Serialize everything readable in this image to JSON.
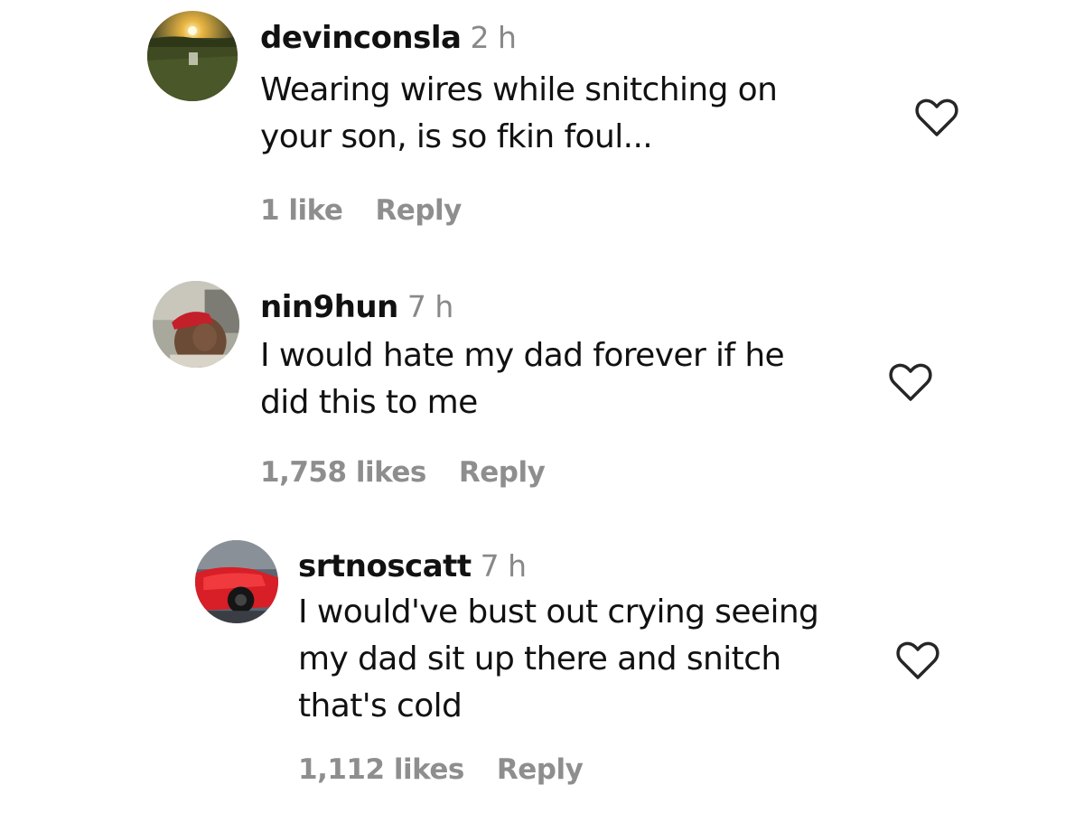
{
  "comments": [
    {
      "username": "devinconsla",
      "time": "2 h",
      "lines": [
        "Wearing wires while snitching on",
        "your son, is so fkin foul..."
      ],
      "likes": "1 like",
      "reply": "Reply",
      "avatar": "sunset-field-photo",
      "like_icon": "heart-outline-icon"
    },
    {
      "username": "nin9hun",
      "time": "7 h",
      "lines": [
        "I would hate my dad forever if he",
        "did this to me"
      ],
      "likes": "1,758 likes",
      "reply": "Reply",
      "avatar": "man-red-cap-photo",
      "like_icon": "heart-outline-icon"
    },
    {
      "username": "srtnoscatt",
      "time": "7 h",
      "lines": [
        "I would've bust out crying seeing",
        "my dad sit up there and snitch",
        "that's cold"
      ],
      "likes": "1,112 likes",
      "reply": "Reply",
      "avatar": "red-car-photo",
      "like_icon": "heart-outline-icon"
    }
  ],
  "colors": {
    "text": "#111111",
    "muted": "#8e8e8e",
    "background": "#ffffff"
  }
}
